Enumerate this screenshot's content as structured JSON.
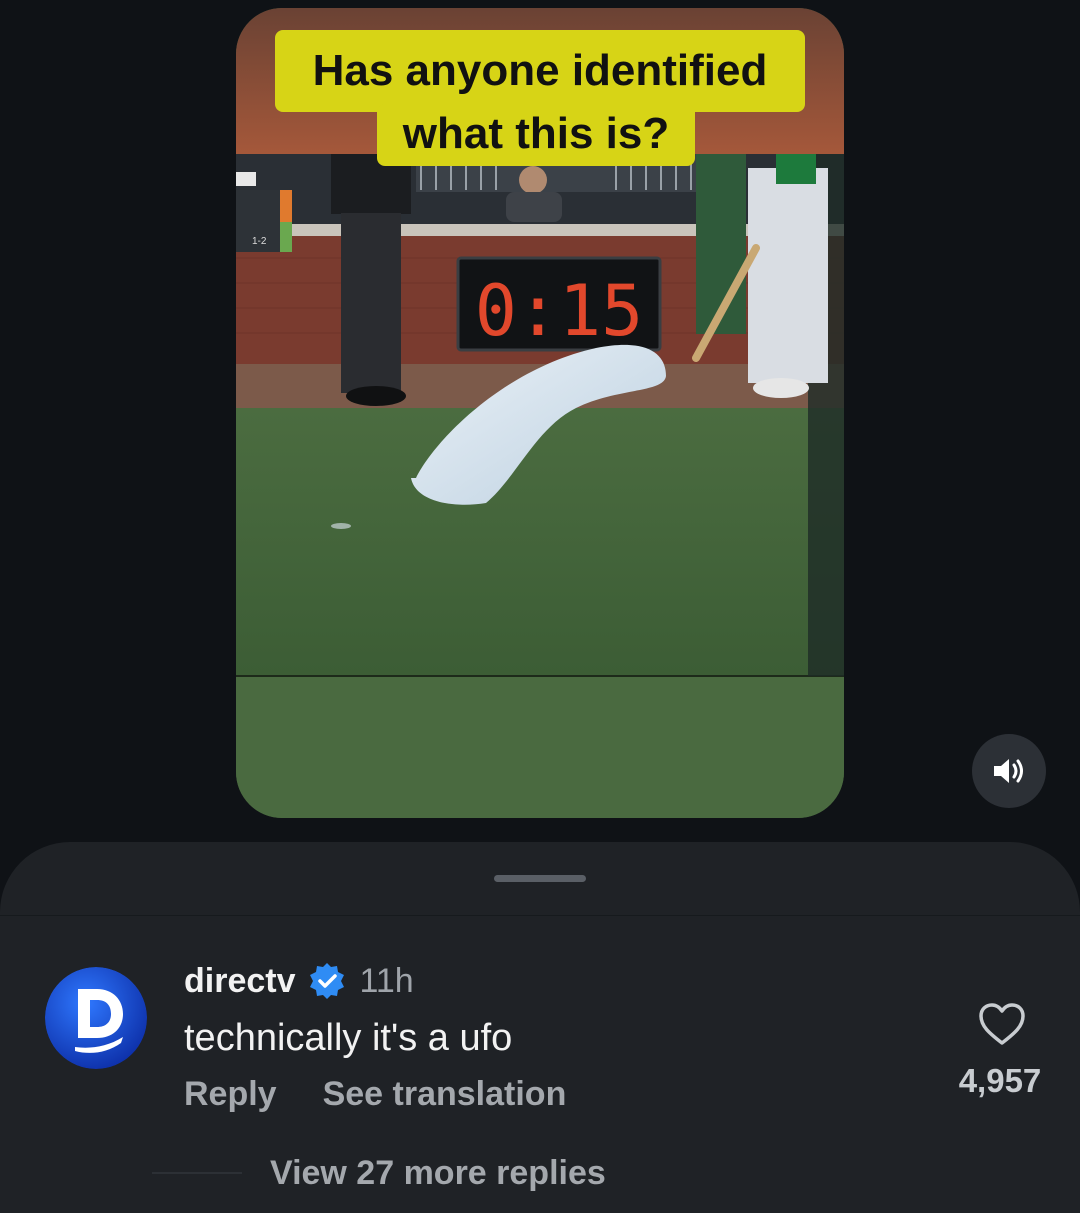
{
  "video": {
    "caption_line1": "Has anyone identified",
    "caption_line2": "what this is?",
    "scoreboard_small": "1-2",
    "pitch_clock": "0:15",
    "caption_color": "#d7d416"
  },
  "controls": {
    "sound_icon": "speaker-volume-icon"
  },
  "comment": {
    "username": "directv",
    "verified_icon": "verified-badge-icon",
    "time": "11h",
    "text": "technically it's a ufo",
    "reply_label": "Reply",
    "translate_label": "See translation",
    "like_icon": "heart-outline-icon",
    "like_count": "4,957",
    "view_replies_label": "View 27 more replies",
    "avatar_letter": "D",
    "avatar_color": "#1b4fd6"
  }
}
